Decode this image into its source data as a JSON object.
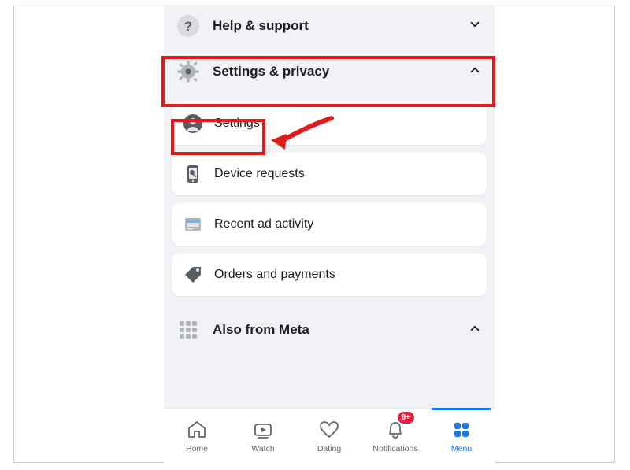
{
  "sections": {
    "help": {
      "label": "Help & support",
      "expanded": false
    },
    "settings_privacy": {
      "label": "Settings & privacy",
      "expanded": true
    },
    "also_meta": {
      "label": "Also from Meta",
      "expanded": true
    }
  },
  "settings_items": [
    {
      "label": "Settings"
    },
    {
      "label": "Device requests"
    },
    {
      "label": "Recent ad activity"
    },
    {
      "label": "Orders and payments"
    }
  ],
  "tabs": [
    {
      "label": "Home",
      "active": false,
      "badge": null
    },
    {
      "label": "Watch",
      "active": false,
      "badge": null
    },
    {
      "label": "Dating",
      "active": false,
      "badge": null
    },
    {
      "label": "Notifications",
      "active": false,
      "badge": "9+"
    },
    {
      "label": "Menu",
      "active": true,
      "badge": null
    }
  ],
  "annotation": {
    "highlight_settings_privacy": true,
    "highlight_settings_item": true,
    "arrow": true
  }
}
